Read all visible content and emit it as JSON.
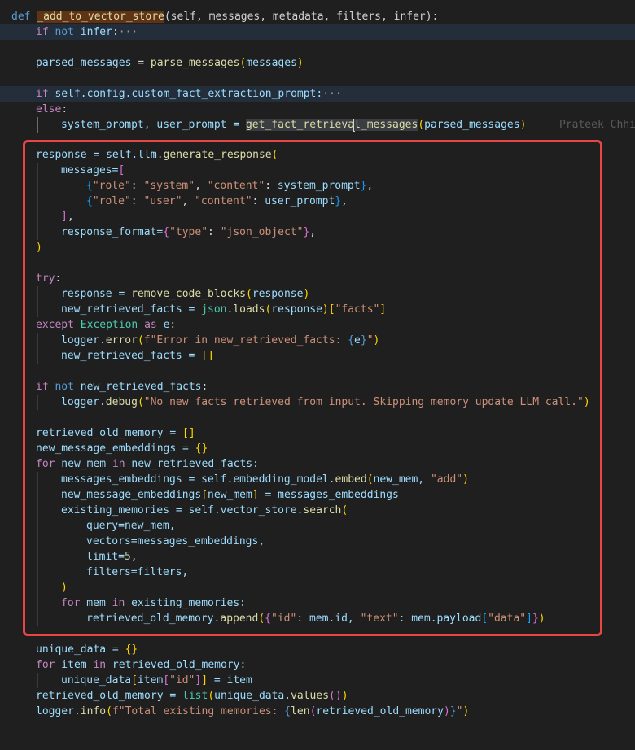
{
  "editor": {
    "blame_text": "Prateek Chhi",
    "annotation_color": "#e84545"
  },
  "code": {
    "l1_def": "def",
    "l1_fn": "_add_to_vector_store",
    "l1_params": "(self, messages, metadata, filters, infer):",
    "l2_if": "if",
    "l2_not": "not",
    "l2_infer": "infer",
    "l2_colon": ":",
    "l2_fold": "···",
    "l4_var": "parsed_messages",
    "l4_eq": " = ",
    "l4_fn": "parse_messages",
    "l4_open": "(",
    "l4_arg": "messages",
    "l4_close": ")",
    "l6_if": "if",
    "l6_expr": " self.config.custom_fact_extraction_prompt:",
    "l6_fold": "···",
    "l7_else": "else",
    "l7_colon": ":",
    "l8_vars": "system_prompt, user_prompt = ",
    "l8_fn_a": "get_fact_retrieva",
    "l8_fn_b": "l_messages",
    "l8_open": "(",
    "l8_arg": "parsed_messages",
    "l8_close": ")",
    "r1_a": "response = self.llm.",
    "r1_fn": "generate_response",
    "r1_open": "(",
    "r2_a": "messages=",
    "r2_open": "[",
    "r3_open": "{",
    "r3_k1": "\"role\"",
    "r3_c1": ": ",
    "r3_v1": "\"system\"",
    "r3_sep": ", ",
    "r3_k2": "\"content\"",
    "r3_c2": ": ",
    "r3_v2": "system_prompt",
    "r3_close": "}",
    "r3_end": ",",
    "r4_open": "{",
    "r4_k1": "\"role\"",
    "r4_c1": ": ",
    "r4_v1": "\"user\"",
    "r4_sep": ", ",
    "r4_k2": "\"content\"",
    "r4_c2": ": ",
    "r4_v2": "user_prompt",
    "r4_close": "}",
    "r4_end": ",",
    "r5_close": "]",
    "r5_end": ",",
    "r6_a": "response_format=",
    "r6_open": "{",
    "r6_k": "\"type\"",
    "r6_c": ": ",
    "r6_v": "\"json_object\"",
    "r6_close": "}",
    "r6_end": ",",
    "r7_close": ")",
    "t1_try": "try",
    "t1_colon": ":",
    "t2_a": "response = ",
    "t2_fn": "remove_code_blocks",
    "t2_open": "(",
    "t2_arg": "response",
    "t2_close": ")",
    "t3_a": "new_retrieved_facts = ",
    "t3_mod": "json",
    "t3_dot": ".",
    "t3_fn": "loads",
    "t3_open": "(",
    "t3_arg": "response",
    "t3_close": ")",
    "t3_bopen": "[",
    "t3_key": "\"facts\"",
    "t3_bclose": "]",
    "t4_except": "except",
    "t4_sp": " ",
    "t4_type": "Exception",
    "t4_as": " as ",
    "t4_e": "e",
    "t4_colon": ":",
    "t5_a": "logger.",
    "t5_fn": "error",
    "t5_open": "(",
    "t5_s1": "f\"Error in new_retrieved_facts: ",
    "t5_b1": "{",
    "t5_e": "e",
    "t5_b2": "}",
    "t5_s2": "\"",
    "t5_close": ")",
    "t6_a": "new_retrieved_facts = ",
    "t6_list": "[]",
    "i1_if": "if",
    "i1_not": " not ",
    "i1_var": "new_retrieved_facts",
    "i1_colon": ":",
    "i2_a": "logger.",
    "i2_fn": "debug",
    "i2_open": "(",
    "i2_s": "\"No new facts retrieved from input. Skipping memory update LLM call.\"",
    "i2_close": ")",
    "m1_a": "retrieved_old_memory = ",
    "m1_list": "[]",
    "m2_a": "new_message_embeddings = ",
    "m2_dict": "{}",
    "m3_for": "for",
    "m3_var": " new_mem ",
    "m3_in": "in",
    "m3_iter": " new_retrieved_facts:",
    "m4_a": "messages_embeddings = self.embedding_model.",
    "m4_fn": "embed",
    "m4_open": "(",
    "m4_arg": "new_mem, ",
    "m4_s": "\"add\"",
    "m4_close": ")",
    "m5_a": "new_message_embeddings",
    "m5_bopen": "[",
    "m5_key": "new_mem",
    "m5_bclose": "]",
    "m5_b": " = messages_embeddings",
    "m6_a": "existing_memories = self.vector_store.",
    "m6_fn": "search",
    "m6_open": "(",
    "m7": "query=new_mem,",
    "m8": "vectors=messages_embeddings,",
    "m9_a": "limit=",
    "m9_n": "5",
    "m9_end": ",",
    "m10": "filters=filters,",
    "m11_close": ")",
    "m12_for": "for",
    "m12_var": " mem ",
    "m12_in": "in",
    "m12_iter": " existing_memories:",
    "m13_a": "retrieved_old_memory.",
    "m13_fn": "append",
    "m13_open": "(",
    "m13_dopen": "{",
    "m13_k1": "\"id\"",
    "m13_v1": ": mem.id, ",
    "m13_k2": "\"text\"",
    "m13_v2": ": mem.payload",
    "m13_bopen": "[",
    "m13_k3": "\"data\"",
    "m13_bclose": "]",
    "m13_dclose": "}",
    "m13_close": ")",
    "u1_a": "unique_data = ",
    "u1_dict": "{}",
    "u2_for": "for",
    "u2_var": " item ",
    "u2_in": "in",
    "u2_iter": " retrieved_old_memory:",
    "u3_a": "unique_data",
    "u3_bopen": "[",
    "u3_b": "item",
    "u3_b2open": "[",
    "u3_key": "\"id\"",
    "u3_b2close": "]",
    "u3_bclose": "]",
    "u3_c": " = item",
    "u4_a": "retrieved_old_memory = ",
    "u4_fn": "list",
    "u4_open": "(",
    "u4_b": "unique_data.",
    "u4_fn2": "values",
    "u4_p": "()",
    "u4_close": ")",
    "u5_a": "logger.",
    "u5_fn": "info",
    "u5_open": "(",
    "u5_s1": "f\"Total existing memories: ",
    "u5_b1": "{",
    "u5_fn2": "len",
    "u5_p1": "(",
    "u5_arg": "retrieved_old_memory",
    "u5_p2": ")",
    "u5_b2": "}",
    "u5_s2": "\"",
    "u5_close": ")"
  }
}
